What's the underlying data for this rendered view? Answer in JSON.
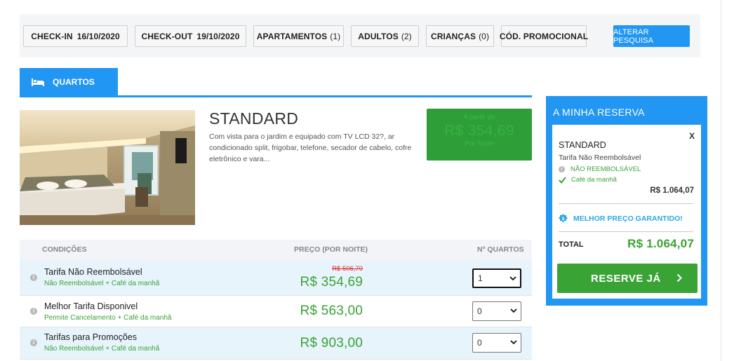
{
  "search": {
    "checkin_label": "CHECK-IN",
    "checkin_value": "16/10/2020",
    "checkout_label": "CHECK-OUT",
    "checkout_value": "19/10/2020",
    "apartments_label": "APARTAMENTOS",
    "apartments_value": "(1)",
    "adults_label": "ADULTOS",
    "adults_value": "(2)",
    "children_label": "CRIANÇAS",
    "children_value": "(0)",
    "promo_label": "CÓD. PROMOCIONAL",
    "change_button": "ALTERAR PESQUISA"
  },
  "tabs": {
    "rooms_label": "QUARTOS",
    "icon": "bed-icon"
  },
  "room": {
    "title": "STANDARD",
    "description": "Com vista para o jardim e equipado com TV LCD 32?, ar condicionado split, frigobar, telefone, secador de cabelo, cofre eletrônico e vara...",
    "price_from": "A partir de",
    "price": "R$ 354,69",
    "price_per": "Por Noite"
  },
  "rates": {
    "headers": {
      "conditions": "CONDIÇÕES",
      "price": "PREÇO (POR NOITE)",
      "rooms": "Nº QUARTOS"
    },
    "rows": [
      {
        "name": "Tarifa Não Reembolsável",
        "sub": "Não Reembolsável + Café da manhã",
        "old_price": "R$ 506,70",
        "price": "R$ 354,69",
        "qty": "1"
      },
      {
        "name": "Melhor Tarifa Disponivel",
        "sub": "Permite Cancelamento + Café da manhã",
        "old_price": "",
        "price": "R$ 563,00",
        "qty": "0"
      },
      {
        "name": "Tarifas para Promoções",
        "sub": "Não Reembolsável + Café da manhã",
        "old_price": "",
        "price": "R$ 903,00",
        "qty": "0"
      }
    ]
  },
  "reservation": {
    "title": "A MINHA RESERVA",
    "close": "X",
    "room": "STANDARD",
    "tarifa": "Tarifa Não Reembolsável",
    "non_refundable": "NÃO REEMBOLSÁVEL",
    "breakfast": "Café da manhã",
    "line_total": "R$ 1.064,07",
    "best_price": "MELHOR PREÇO GARANTIDO!",
    "total_label": "TOTAL",
    "total_value": "R$ 1.064,07",
    "book_button": "RESERVE JÁ"
  },
  "colors": {
    "accent": "#2196f3",
    "success": "#3aa335",
    "strike": "#d9302c"
  }
}
